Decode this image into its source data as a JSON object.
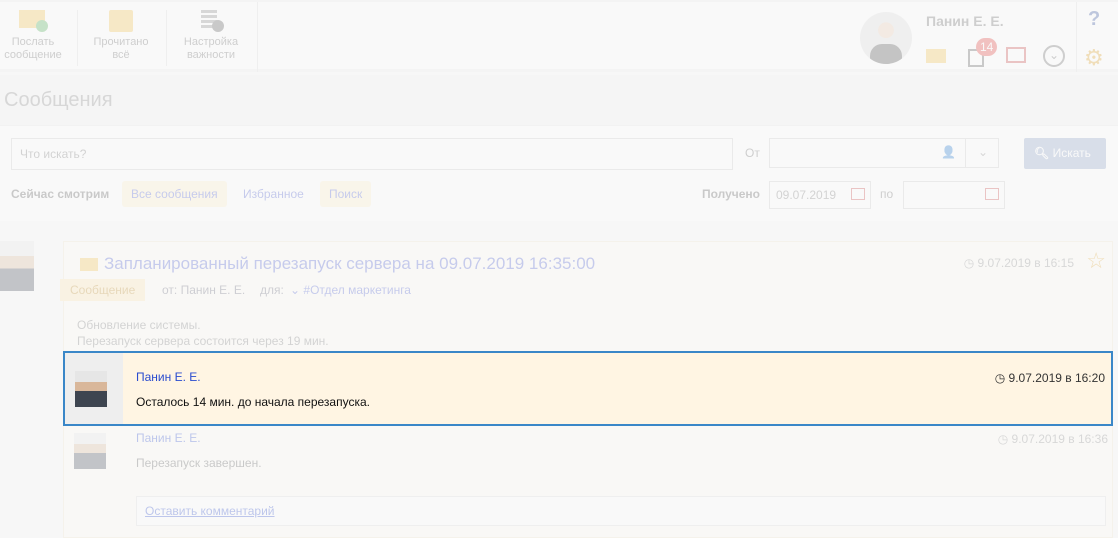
{
  "toolbar": {
    "send": "Послать сообщение",
    "read_all": "Прочитано всё",
    "importance": "Настройка важности"
  },
  "user": {
    "name": "Панин Е. Е.",
    "tasks_badge": "14",
    "help": "?"
  },
  "page": {
    "title": "Сообщения"
  },
  "filters": {
    "search_placeholder": "Что искать?",
    "from_label": "От",
    "search_button": "Искать",
    "now_viewing": "Сейчас смотрим",
    "tabs": [
      "Все сообщения",
      "Избранное",
      "Поиск"
    ],
    "received_label": "Получено",
    "date_from": "09.07.2019",
    "to_label": "по",
    "date_to": ""
  },
  "message": {
    "title": "Запланированный перезапуск сервера на 09.07.2019 16:35:00",
    "time": "9.07.2019 в 16:15",
    "type_badge": "Сообщение",
    "from": "от: Панин Е. Е.",
    "to_label": "для:",
    "recipient": "#Отдел маркетинга",
    "body": [
      "Обновление системы.",
      "Перезапуск сервера состоится через 19 мин."
    ]
  },
  "comments": [
    {
      "author": "Панин Е. Е.",
      "time": "9.07.2019 в 16:20",
      "text": "Осталось 14 мин. до начала перезапуска."
    },
    {
      "author": "Панин Е. Е.",
      "time": "9.07.2019 в 16:36",
      "text": "Перезапуск завершен."
    }
  ],
  "leave_comment": "Оставить комментарий",
  "colors": {
    "highlight_border": "#3a87c8",
    "highlight_bg": "#fff5e3",
    "link": "#2a4ccf"
  }
}
